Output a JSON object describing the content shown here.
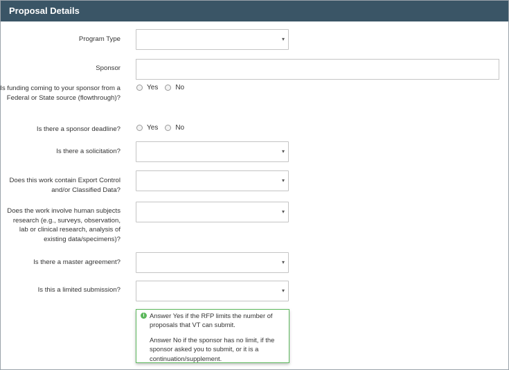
{
  "header": {
    "title": "Proposal Details"
  },
  "fields": {
    "program_type": {
      "label": "Program Type",
      "value": ""
    },
    "sponsor": {
      "label": "Sponsor",
      "value": ""
    },
    "flowthrough": {
      "label": "Is funding coming to your sponsor from a Federal or State source (flowthrough)?",
      "yes": "Yes",
      "no": "No"
    },
    "deadline": {
      "label": "Is there a sponsor deadline?",
      "yes": "Yes",
      "no": "No"
    },
    "solicitation": {
      "label": "Is there a solicitation?",
      "value": ""
    },
    "export_control": {
      "label": "Does this work contain Export Control and/or Classified Data?",
      "value": ""
    },
    "human_subjects": {
      "label": "Does the work involve human subjects research (e.g., surveys, observation, lab or clinical research, analysis of existing data/specimens)?",
      "value": ""
    },
    "master_agreement": {
      "label": "Is there a master agreement?",
      "value": ""
    },
    "limited_submission": {
      "label": "Is this a limited submission?",
      "value": ""
    }
  },
  "tooltip": {
    "line1": "Answer Yes if the RFP limits the number of proposals that VT can submit.",
    "line2": "Answer No if the sponsor has no limit, if the sponsor asked you to submit, or it is a continuation/supplement."
  },
  "icons": {
    "dropdown": "▾",
    "info": "i"
  },
  "colors": {
    "header_bg": "#3a5566",
    "tooltip_border": "#5cb85c"
  }
}
